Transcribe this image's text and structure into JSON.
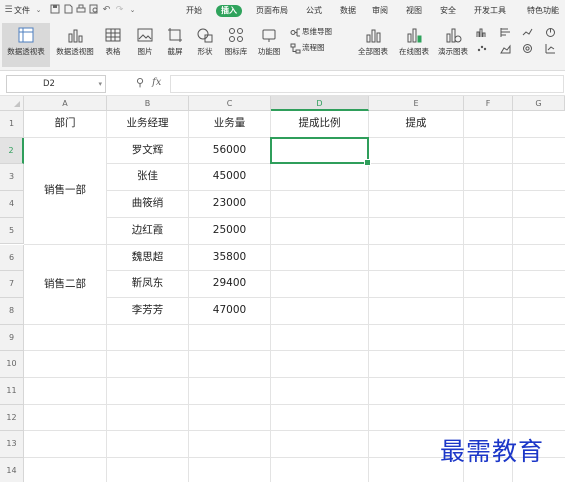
{
  "menubar": {
    "file_label": "文件",
    "tabs": [
      "开始",
      "插入",
      "页面布局",
      "公式",
      "数据",
      "审阅",
      "视图",
      "安全",
      "开发工具",
      "特色功能"
    ],
    "active_tab": "插入"
  },
  "ribbon": {
    "pivot_table": "数据透视表",
    "pivot_chart": "数据透视图",
    "table": "表格",
    "picture": "图片",
    "screenshot": "截屏",
    "shape": "形状",
    "icon_library": "图标库",
    "function_chart": "功能图",
    "mind_map": "思维导图",
    "flowchart": "流程图",
    "all_charts": "全部图表",
    "online_charts": "在线图表",
    "demo_charts": "演示图表"
  },
  "formula_bar": {
    "cell_ref": "D2",
    "fx_label": "fx",
    "formula": ""
  },
  "sheet": {
    "columns": [
      "A",
      "B",
      "C",
      "D",
      "E",
      "F",
      "G"
    ],
    "selected_column": "D",
    "rows": [
      "1",
      "2",
      "3",
      "4",
      "5",
      "6",
      "7",
      "8",
      "9",
      "10",
      "11",
      "12",
      "13",
      "14"
    ],
    "selected_row": "2",
    "header": [
      "部门",
      "业务经理",
      "业务量",
      "提成比例",
      "提成"
    ],
    "merged": [
      {
        "label": "销售一部"
      },
      {
        "label": "销售二部"
      }
    ],
    "data": [
      {
        "manager": "罗文辉",
        "volume": "56000"
      },
      {
        "manager": "张佳",
        "volume": "45000"
      },
      {
        "manager": "曲筱绡",
        "volume": "23000"
      },
      {
        "manager": "边红霞",
        "volume": "25000"
      },
      {
        "manager": "魏思超",
        "volume": "35800"
      },
      {
        "manager": "靳凤东",
        "volume": "29400"
      },
      {
        "manager": "李芳芳",
        "volume": "47000"
      }
    ]
  },
  "watermark": "最需教育",
  "colors": {
    "accent": "#2fa35c",
    "watermark": "#1c37c8"
  }
}
